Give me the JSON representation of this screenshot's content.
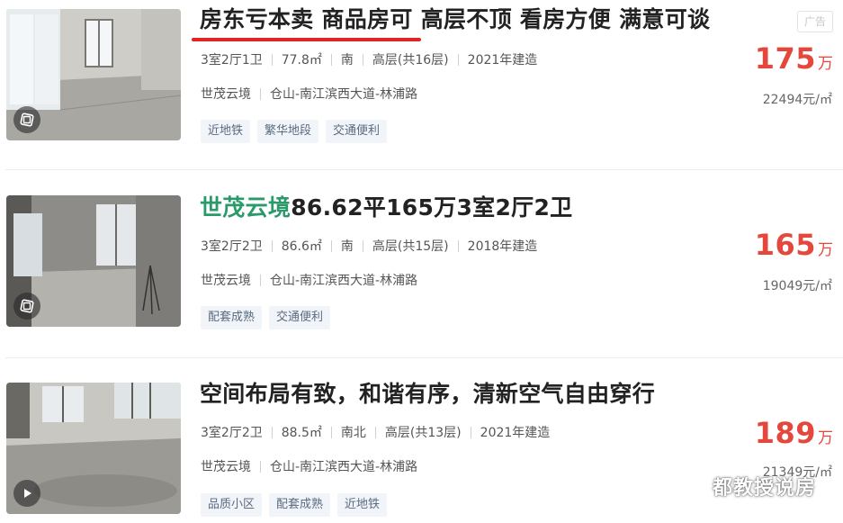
{
  "listings": [
    {
      "title_plain": "房东亏本卖 商品房可 高层不顶 看房方便 满意可谈",
      "layout": "3室2厅1卫",
      "area": "77.8㎡",
      "orientation": "南",
      "floor": "高层(共16层)",
      "built": "2021年建造",
      "community": "世茂云境",
      "location": "仓山-南江滨西大道-林浦路",
      "tags": [
        "近地铁",
        "繁华地段",
        "交通便利"
      ],
      "price": "175",
      "price_unit": "万",
      "unit_price": "22494元/㎡",
      "ad_label": "广告",
      "thumb_icon": "vr-icon"
    },
    {
      "title_highlight": "世茂云境",
      "title_rest": "86.62平165万3室2厅2卫",
      "layout": "3室2厅2卫",
      "area": "86.6㎡",
      "orientation": "南",
      "floor": "高层(共15层)",
      "built": "2018年建造",
      "community": "世茂云境",
      "location": "仓山-南江滨西大道-林浦路",
      "tags": [
        "配套成熟",
        "交通便利"
      ],
      "price": "165",
      "price_unit": "万",
      "unit_price": "19049元/㎡",
      "thumb_icon": "vr-icon"
    },
    {
      "title_plain": "空间布局有致，和谐有序，清新空气自由穿行",
      "layout": "3室2厅2卫",
      "area": "88.5㎡",
      "orientation": "南北",
      "floor": "高层(共13层)",
      "built": "2021年建造",
      "community": "世茂云境",
      "location": "仓山-南江滨西大道-林浦路",
      "tags": [
        "品质小区",
        "配套成熟",
        "近地铁"
      ],
      "price": "189",
      "price_unit": "万",
      "unit_price": "21349元/㎡",
      "thumb_icon": "play-icon"
    }
  ],
  "watermark": {
    "text": "都教授说房",
    "icon": "wechat-icon"
  },
  "colors": {
    "price": "#e4473b",
    "highlight": "#2b9a6b",
    "underline": "#e02424",
    "tag_bg": "#f1f4f8"
  }
}
